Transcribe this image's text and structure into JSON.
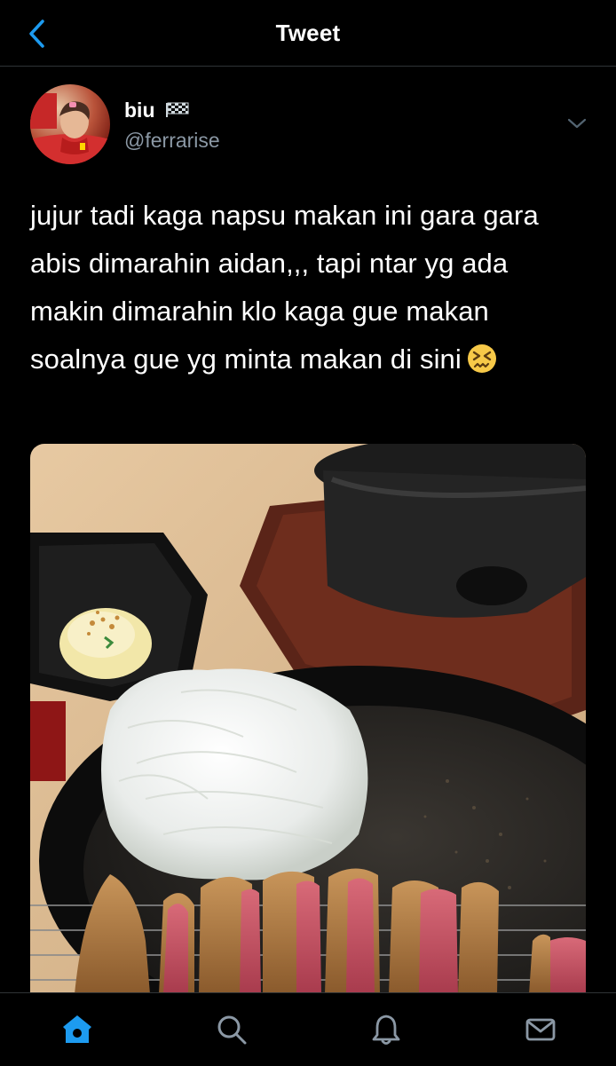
{
  "header": {
    "title": "Tweet",
    "back_icon": "chevron-left-icon"
  },
  "tweet": {
    "author": {
      "display_name": "biu",
      "flag_icon": "checkered-flag-icon",
      "handle": "@ferrarise"
    },
    "text": "jujur tadi kaga napsu makan ini gara gara abis dimarahin aidan,,, tapi ntar yg ada makin dimarahin klo kaga gue makan soalnya gue yg minta makan di sini",
    "emoji": "confounded-face-emoji",
    "media_description_icon": "photo"
  },
  "tabbar": {
    "items": [
      {
        "name": "home",
        "icon": "home-icon",
        "active": true
      },
      {
        "name": "search",
        "icon": "search-icon",
        "active": false
      },
      {
        "name": "notifications",
        "icon": "bell-icon",
        "active": false
      },
      {
        "name": "messages",
        "icon": "mail-icon",
        "active": false
      }
    ]
  },
  "colors": {
    "background": "#000000",
    "accent": "#1d9bf0",
    "secondary_text": "#8b98a5",
    "divider": "#2f3336"
  }
}
